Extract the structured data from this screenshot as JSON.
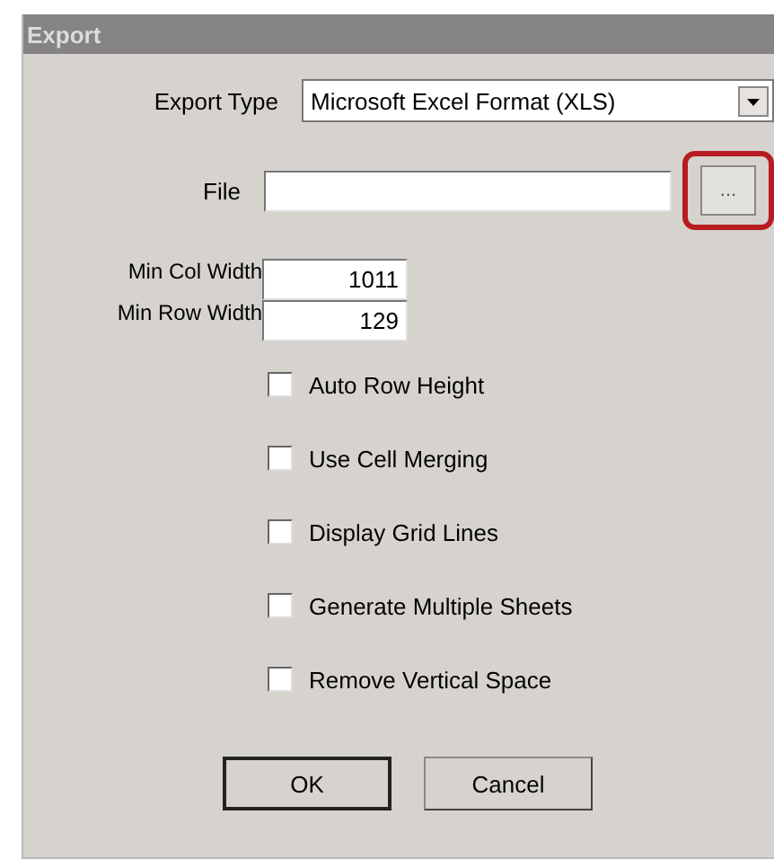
{
  "window": {
    "title": "Export"
  },
  "export_type": {
    "label": "Export Type",
    "value": "Microsoft Excel Format (XLS)"
  },
  "file": {
    "label": "File",
    "browse": "..."
  },
  "min_col_width": {
    "label": "Min Col Width",
    "value": "1011"
  },
  "min_row_width": {
    "label": "Min Row Width",
    "value": "129"
  },
  "options": [
    {
      "label": "Auto Row Height",
      "checked": false
    },
    {
      "label": "Use Cell Merging",
      "checked": false
    },
    {
      "label": "Display Grid Lines",
      "checked": false
    },
    {
      "label": "Generate Multiple Sheets",
      "checked": false
    },
    {
      "label": "Remove Vertical Space",
      "checked": false
    }
  ],
  "buttons": [
    {
      "label": "OK",
      "default": true
    },
    {
      "label": "Cancel",
      "default": false
    }
  ]
}
